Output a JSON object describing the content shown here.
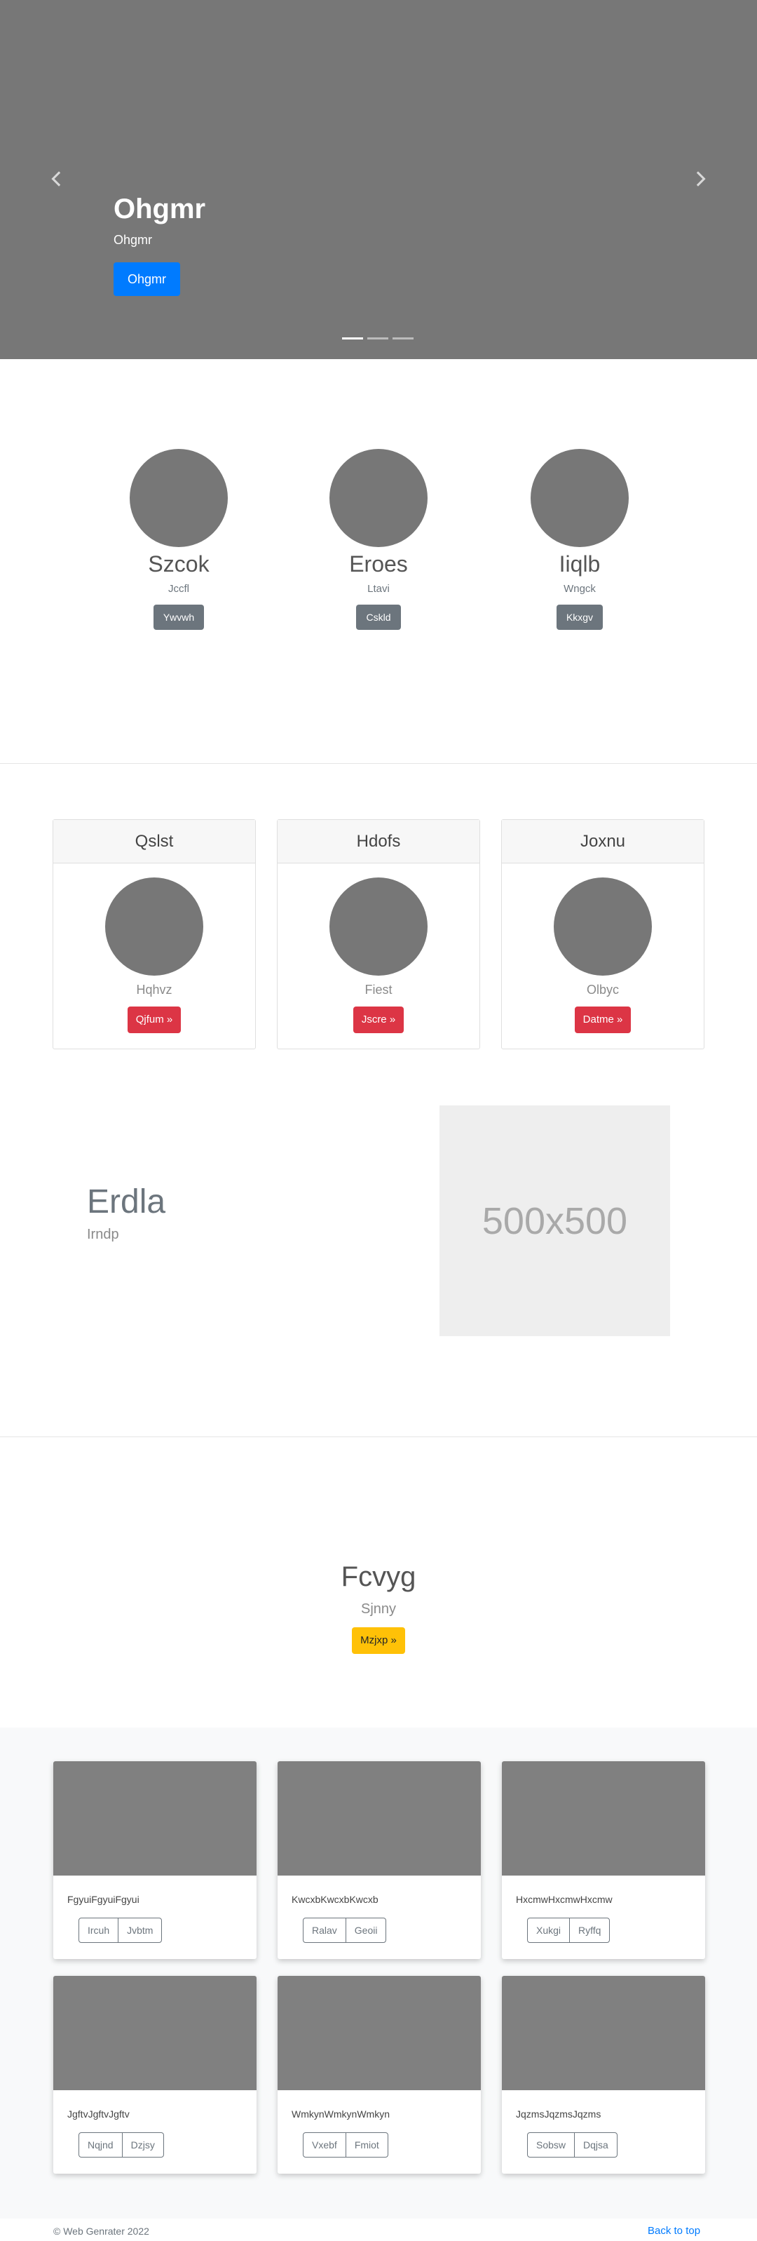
{
  "carousel": {
    "heading": "Ohgmr",
    "lead": "Ohgmr",
    "button": "Ohgmr",
    "prev_icon": "chevron-left-icon",
    "next_icon": "chevron-right-icon",
    "slide_count": 3,
    "active_slide": 1
  },
  "profiles": [
    {
      "name": "Szcok",
      "sub": "Jccfl",
      "button": "Ywvwh"
    },
    {
      "name": "Eroes",
      "sub": "Ltavi",
      "button": "Cskld"
    },
    {
      "name": "Iiqlb",
      "sub": "Wngck",
      "button": "Kkxgv"
    }
  ],
  "panels": [
    {
      "title": "Qslst",
      "caption": "Hqhvz",
      "button": "Qjfum »"
    },
    {
      "title": "Hdofs",
      "caption": "Fiest",
      "button": "Jscre »"
    },
    {
      "title": "Joxnu",
      "caption": "Olbyc",
      "button": "Datme »"
    }
  ],
  "feature": {
    "title": "Erdla",
    "sub": "Irndp",
    "placeholder": "500x500"
  },
  "jumbotron": {
    "title": "Fcvyg",
    "lead": "Sjnny",
    "button": "Mzjxp »"
  },
  "album": [
    {
      "text": "FgyuiFgyuiFgyui",
      "btn1": "Ircuh",
      "btn2": "Jvbtm"
    },
    {
      "text": "KwcxbKwcxbKwcxb",
      "btn1": "Ralav",
      "btn2": "Geoii"
    },
    {
      "text": "HxcmwHxcmwHxcmw",
      "btn1": "Xukgi",
      "btn2": "Ryffq"
    },
    {
      "text": "JgftvJgftvJgftv",
      "btn1": "Nqjnd",
      "btn2": "Dzjsy"
    },
    {
      "text": "WmkynWmkynWmkyn",
      "btn1": "Vxebf",
      "btn2": "Fmiot"
    },
    {
      "text": "JqzmsJqzmsJqzms",
      "btn1": "Sobsw",
      "btn2": "Dqjsa"
    }
  ],
  "footer": {
    "copyright": "© Web Genrater 2022",
    "back_to_top": "Back to top"
  },
  "colors": {
    "primary": "#007bff",
    "secondary": "#6c757d",
    "danger": "#dc3545",
    "warning": "#ffc107",
    "placeholder_gray": "#777777"
  }
}
